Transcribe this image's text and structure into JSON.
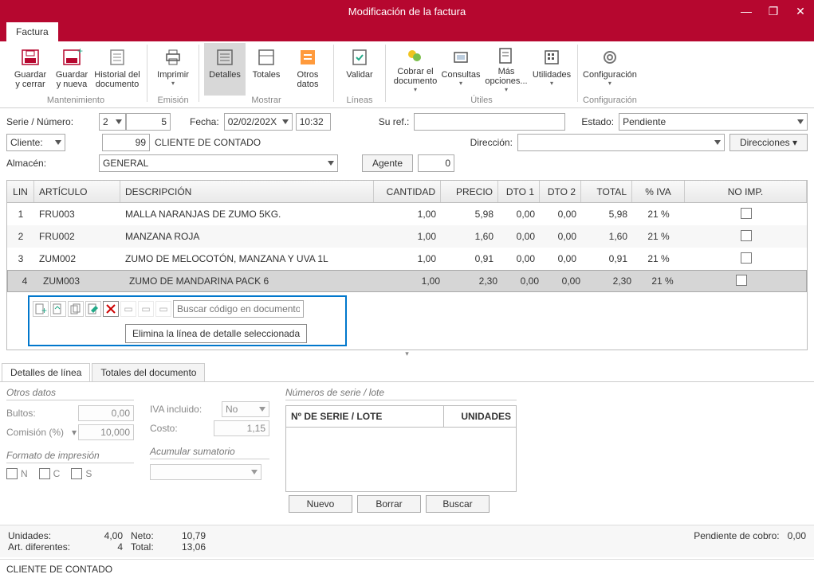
{
  "window": {
    "title": "Modificación de la factura"
  },
  "tab": {
    "label": "Factura"
  },
  "ribbon": {
    "save_close": "Guardar\ny cerrar",
    "save_new": "Guardar\ny nueva",
    "history": "Historial del\ndocumento",
    "print": "Imprimir",
    "details": "Detalles",
    "totals": "Totales",
    "other": "Otros\ndatos",
    "validate": "Validar",
    "collect": "Cobrar el\ndocumento",
    "queries": "Consultas",
    "more": "Más\nopciones...",
    "util": "Utilidades",
    "config": "Configuración",
    "g_maint": "Mantenimiento",
    "g_emit": "Emisión",
    "g_show": "Mostrar",
    "g_lines": "Líneas",
    "g_util": "Útiles",
    "g_conf": "Configuración"
  },
  "form": {
    "serie_lbl": "Serie / Número:",
    "serie_val": "2",
    "num_val": "5",
    "fecha_lbl": "Fecha:",
    "fecha_val": "02/02/202X",
    "hora_val": "10:32",
    "suref_lbl": "Su ref.:",
    "estado_lbl": "Estado:",
    "estado_val": "Pendiente",
    "cliente_lbl": "Cliente:",
    "cliente_num": "99",
    "cliente_name": "CLIENTE DE CONTADO",
    "dir_lbl": "Dirección:",
    "dir_btn": "Direcciones",
    "alm_lbl": "Almacén:",
    "alm_val": "GENERAL",
    "agente_lbl": "Agente",
    "agente_val": "0"
  },
  "grid": {
    "h_lin": "LIN",
    "h_art": "ARTÍCULO",
    "h_desc": "DESCRIPCIÓN",
    "h_cant": "CANTIDAD",
    "h_prec": "PRECIO",
    "h_d1": "DTO 1",
    "h_d2": "DTO 2",
    "h_tot": "TOTAL",
    "h_iva": "% IVA",
    "h_noimp": "NO IMP.",
    "rows": [
      {
        "lin": "1",
        "art": "FRU003",
        "desc": "MALLA NARANJAS DE ZUMO 5KG.",
        "cant": "1,00",
        "prec": "5,98",
        "d1": "0,00",
        "d2": "0,00",
        "tot": "5,98",
        "iva": "21 %"
      },
      {
        "lin": "2",
        "art": "FRU002",
        "desc": "MANZANA ROJA",
        "cant": "1,00",
        "prec": "1,60",
        "d1": "0,00",
        "d2": "0,00",
        "tot": "1,60",
        "iva": "21 %"
      },
      {
        "lin": "3",
        "art": "ZUM002",
        "desc": "ZUMO DE MELOCOTÓN, MANZANA Y UVA 1L",
        "cant": "1,00",
        "prec": "0,91",
        "d1": "0,00",
        "d2": "0,00",
        "tot": "0,91",
        "iva": "21 %"
      },
      {
        "lin": "4",
        "art": "ZUM003",
        "desc": "ZUMO DE MANDARINA PACK 6",
        "cant": "1,00",
        "prec": "2,30",
        "d1": "0,00",
        "d2": "0,00",
        "tot": "2,30",
        "iva": "21 %"
      }
    ],
    "search_ph": "Buscar código en documento",
    "tooltip": "Elimina la línea de detalle seleccionada"
  },
  "dtabs": {
    "t1": "Detalles de línea",
    "t2": "Totales del documento"
  },
  "detail": {
    "otros": "Otros datos",
    "bultos": "Bultos:",
    "bultos_v": "0,00",
    "comision": "Comisión (%)",
    "comision_v": "10,000",
    "iva_inc": "IVA incluido:",
    "iva_inc_v": "No",
    "costo": "Costo:",
    "costo_v": "1,15",
    "formato": "Formato de impresión",
    "n": "N",
    "c": "C",
    "s": "S",
    "acum": "Acumular sumatorio",
    "serie_title": "Números de serie / lote",
    "serie_h1": "Nº DE SERIE / LOTE",
    "serie_h2": "UNIDADES",
    "nuevo": "Nuevo",
    "borrar": "Borrar",
    "buscar": "Buscar"
  },
  "footer": {
    "unid": "Unidades:",
    "unid_v": "4,00",
    "neto": "Neto:",
    "neto_v": "10,79",
    "art": "Art. diferentes:",
    "art_v": "4",
    "total": "Total:",
    "total_v": "13,06",
    "pend": "Pendiente de cobro:",
    "pend_v": "0,00"
  },
  "status": "CLIENTE DE CONTADO"
}
